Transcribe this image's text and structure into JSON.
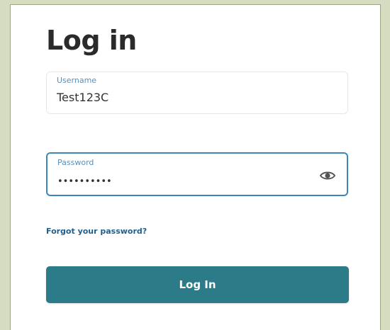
{
  "page": {
    "title": "Log in"
  },
  "username": {
    "label": "Username",
    "value": "Test123C"
  },
  "password": {
    "label": "Password",
    "masked_value": "••••••••••",
    "toggle_icon": "eye-icon"
  },
  "links": {
    "forgot_password": "Forgot your password?"
  },
  "buttons": {
    "login_label": "Log In"
  },
  "colors": {
    "background": "#d5dcbf",
    "panel": "#ffffff",
    "accent": "#2b7b88",
    "focus_border": "#3c86b8",
    "link": "#1f5f8f"
  }
}
